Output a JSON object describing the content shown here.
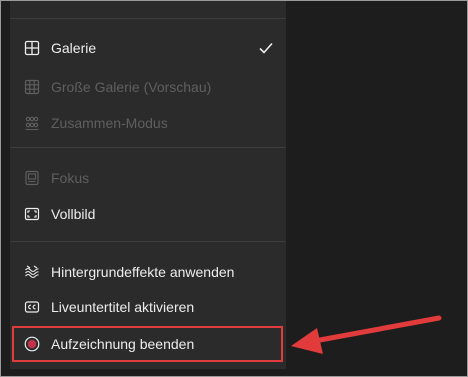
{
  "menu": {
    "items": [
      {
        "label": "Galerie",
        "icon": "grid-icon",
        "disabled": false,
        "checked": true
      },
      {
        "label": "Große Galerie (Vorschau)",
        "icon": "large-grid-icon",
        "disabled": true
      },
      {
        "label": "Zusammen-Modus",
        "icon": "people-group-icon",
        "disabled": true
      },
      {
        "label": "Fokus",
        "icon": "focus-icon",
        "disabled": true
      },
      {
        "label": "Vollbild",
        "icon": "fullscreen-icon",
        "disabled": false
      },
      {
        "label": "Hintergrundeffekte anwenden",
        "icon": "background-effects-icon",
        "disabled": false
      },
      {
        "label": "Liveuntertitel aktivieren",
        "icon": "closed-captions-icon",
        "disabled": false
      },
      {
        "label": "Aufzeichnung beenden",
        "icon": "record-icon",
        "disabled": false,
        "highlighted": true
      }
    ]
  },
  "colors": {
    "menu_bg": "#2b2b2b",
    "page_bg": "#1d1d1d",
    "text": "#ededed",
    "disabled_text": "#5f5f5f",
    "highlight": "#e03c3c",
    "record_dot": "#c4314b"
  }
}
